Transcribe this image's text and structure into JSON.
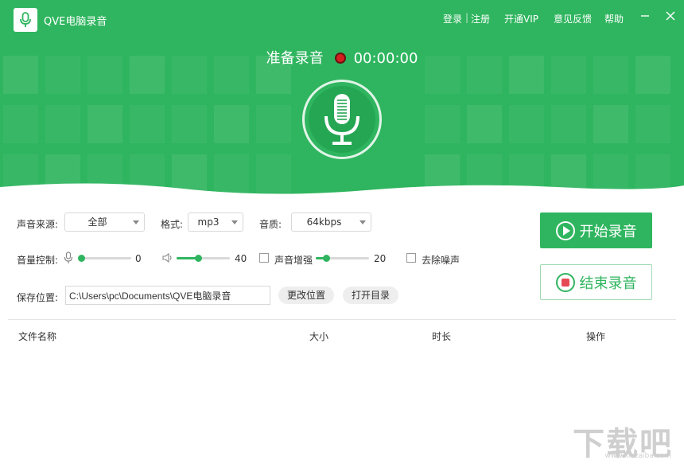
{
  "app": {
    "title": "QVE电脑录音"
  },
  "topnav": {
    "login": "登录",
    "sep": "|",
    "register": "注册",
    "vip": "开通VIP",
    "feedback": "意见反馈",
    "help": "帮助"
  },
  "status": {
    "text": "准备录音",
    "time": "00:00:00"
  },
  "controls": {
    "source_label": "声音来源:",
    "source_value": "全部",
    "format_label": "格式:",
    "format_value": "mp3",
    "quality_label": "音质:",
    "quality_value": "64kbps",
    "volume_label": "音量控制:",
    "mic_volume": "0",
    "mic_level": 0,
    "speaker_volume": "40",
    "speaker_level": 0.4,
    "enhance_label": "声音增强",
    "enhance_volume": "20",
    "enhance_level": 0.2,
    "enhance_checked": false,
    "denoise_label": "去除噪声",
    "denoise_checked": false,
    "save_label": "保存位置:",
    "save_path": "C:\\Users\\pc\\Documents\\QVE电脑录音",
    "change_button": "更改位置",
    "open_button": "打开目录"
  },
  "actions": {
    "start": "开始录音",
    "stop": "结束录音"
  },
  "table": {
    "columns": [
      "文件名称",
      "大小",
      "时长",
      "操作"
    ]
  },
  "watermark": {
    "text": "下载吧",
    "url": "www.xiazaiba.com"
  },
  "colors": {
    "accent": "#2fb55f",
    "record_dot": "#d41f1f",
    "stop_icon": "#e64b55"
  },
  "icons": [
    "microphone-icon",
    "record-dot-icon",
    "minimize-icon",
    "close-icon",
    "speaker-icon",
    "play-icon",
    "stop-icon",
    "chevron-down-icon"
  ]
}
